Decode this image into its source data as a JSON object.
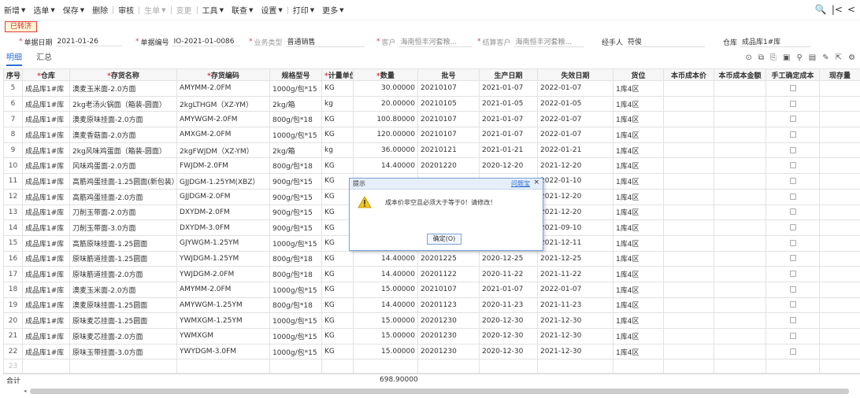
{
  "toolbar": {
    "items": [
      "新增",
      "选单",
      "保存",
      "删除",
      "审核",
      "生单",
      "变更",
      "工具",
      "联查",
      "设置",
      "打印",
      "更多"
    ]
  },
  "status_badge": "已转济",
  "header": {
    "doc_date_label": "单据日期",
    "doc_date": "2021-01-26",
    "doc_no_label": "单据编号",
    "doc_no": "IO-2021-01-0086",
    "biz_type_label": "业务类型",
    "biz_type": "普通销售",
    "customer_label": "客户",
    "customer": "海南恒丰河套粮...",
    "settle_label": "结算客户",
    "settle_customer": "海南恒丰河套粮...",
    "handler_label": "经手人",
    "handler": "符俊",
    "warehouse_label": "仓库",
    "warehouse": "成品库1#库"
  },
  "tabs": [
    "明细",
    "汇总"
  ],
  "table": {
    "columns": [
      "序号",
      "仓库",
      "存货名称",
      "存货编码",
      "规格型号",
      "计量单位",
      "数量",
      "批号",
      "生产日期",
      "失效日期",
      "货位",
      "本币成本价",
      "本币成本金额",
      "手工确定成本",
      "现存量"
    ],
    "rows": [
      [
        "5",
        "成品库1#库",
        "澳麦玉米面-2.0方面",
        "AMYMM-2.0FM",
        "1000g/包*15",
        "KG",
        "30.00000",
        "20210107",
        "2021-01-07",
        "2022-01-07",
        "1库4区"
      ],
      [
        "6",
        "成品库1#库",
        "2kg老汤火锅面（箱装-圆面）",
        "2kgLTHGM（XZ-YM）",
        "2kg/箱",
        "kg",
        "20.00000",
        "20210105",
        "2021-01-05",
        "2022-01-05",
        "1库4区"
      ],
      [
        "7",
        "成品库1#库",
        "澳麦原味挂面-2.0方面",
        "AMYWGM-2.0FM",
        "800g/包*18",
        "KG",
        "100.80000",
        "20210107",
        "2021-01-07",
        "2022-01-07",
        "1库4区"
      ],
      [
        "8",
        "成品库1#库",
        "澳麦香菇面-2.0方面",
        "AMXGM-2.0FM",
        "1000g/包*15",
        "KG",
        "120.00000",
        "20210107",
        "2021-01-07",
        "2022-01-07",
        "1库4区"
      ],
      [
        "9",
        "成品库1#库",
        "2kg风味鸡蛋面（箱装-圆面）",
        "2kgFWJDM（XZ-YM）",
        "2kg/箱",
        "kg",
        "36.00000",
        "20210121",
        "2021-01-21",
        "2022-01-21",
        "1库4区"
      ],
      [
        "10",
        "成品库1#库",
        "风味鸡蛋面-2.0方面",
        "FWJDM-2.0FM",
        "800g/包*18",
        "KG",
        "14.40000",
        "20201220",
        "2020-12-20",
        "2021-12-20",
        "1库4区"
      ],
      [
        "11",
        "成品库1#库",
        "高筋鸡蛋挂面-1.25圆面(新包装）",
        "GJJDGM-1.25YM(XBZ）",
        "900g/包*15",
        "KG",
        "",
        "",
        "",
        "2022-01-10",
        "1库4区"
      ],
      [
        "12",
        "成品库1#库",
        "高筋鸡蛋挂面-2.0方面",
        "GJJDGM-2.0FM",
        "900g/包*15",
        "KG",
        "",
        "",
        "",
        "2021-12-20",
        "1库4区"
      ],
      [
        "13",
        "成品库1#库",
        "刀削玉带面-2.0方面",
        "DXYDM-2.0FM",
        "900g/包*15",
        "KG",
        "",
        "",
        "",
        "2021-12-20",
        "1库4区"
      ],
      [
        "14",
        "成品库1#库",
        "刀削玉带面-3.0方面",
        "DXYDM-3.0FM",
        "900g/包*15",
        "KG",
        "",
        "",
        "",
        "2021-09-10",
        "1库4区"
      ],
      [
        "15",
        "成品库1#库",
        "高筋原味挂面-1.25圆面",
        "GJYWGM-1.25YM",
        "1000g/包*15",
        "KG",
        "",
        "",
        "",
        "2021-12-11",
        "1库4区"
      ],
      [
        "16",
        "成品库1#库",
        "原味筋道挂面-1.25圆面",
        "YWJDGM-1.25YM",
        "800g/包*18",
        "KG",
        "14.40000",
        "20201225",
        "2020-12-25",
        "2021-12-25",
        "1库4区"
      ],
      [
        "17",
        "成品库1#库",
        "原味筋道挂面-2.0方面",
        "YWJDGM-2.0FM",
        "800g/包*18",
        "KG",
        "14.40000",
        "20201122",
        "2020-11-22",
        "2021-11-22",
        "1库4区"
      ],
      [
        "18",
        "成品库1#库",
        "澳麦玉米面-2.0方面",
        "AMYMM-2.0FM",
        "1000g/包*15",
        "KG",
        "15.00000",
        "20210107",
        "2021-01-07",
        "2022-01-07",
        "1库4区"
      ],
      [
        "19",
        "成品库1#库",
        "澳麦原味挂面-1.25圆面",
        "AMYWGM-1.25YM",
        "800g/包*18",
        "KG",
        "14.40000",
        "20201123",
        "2020-11-23",
        "2021-11-23",
        "1库4区"
      ],
      [
        "20",
        "成品库1#库",
        "原味麦芯挂面-1.25圆面",
        "YWMXGM-1.25YM",
        "1000g/包*15",
        "KG",
        "15.00000",
        "20201230",
        "2020-12-30",
        "2021-12-30",
        "1库4区"
      ],
      [
        "21",
        "成品库1#库",
        "原味麦芯挂面-2.0方面",
        "YWMXGM",
        "1000g/包*15",
        "KG",
        "15.00000",
        "20201230",
        "2020-12-30",
        "2021-12-30",
        "1库4区"
      ],
      [
        "22",
        "成品库1#库",
        "原味玉带挂面-3.0方面",
        "YWYDGM-3.0FM",
        "1000g/包*15",
        "KG",
        "15.00000",
        "20201230",
        "2020-12-30",
        "2021-12-30",
        "1库4区"
      ]
    ],
    "empty_row_no": "23"
  },
  "summary": {
    "label": "合计",
    "quantity": "698.90000"
  },
  "dialog": {
    "title": "提示",
    "help": "问题宝",
    "close": "×",
    "message": "成本价非空且必须大于等于0！请修改！",
    "ok": "确定(O)"
  },
  "colors": {
    "accent": "#2b6fd6",
    "required": "#e03a3a",
    "badge_bg": "#fff6d6"
  }
}
